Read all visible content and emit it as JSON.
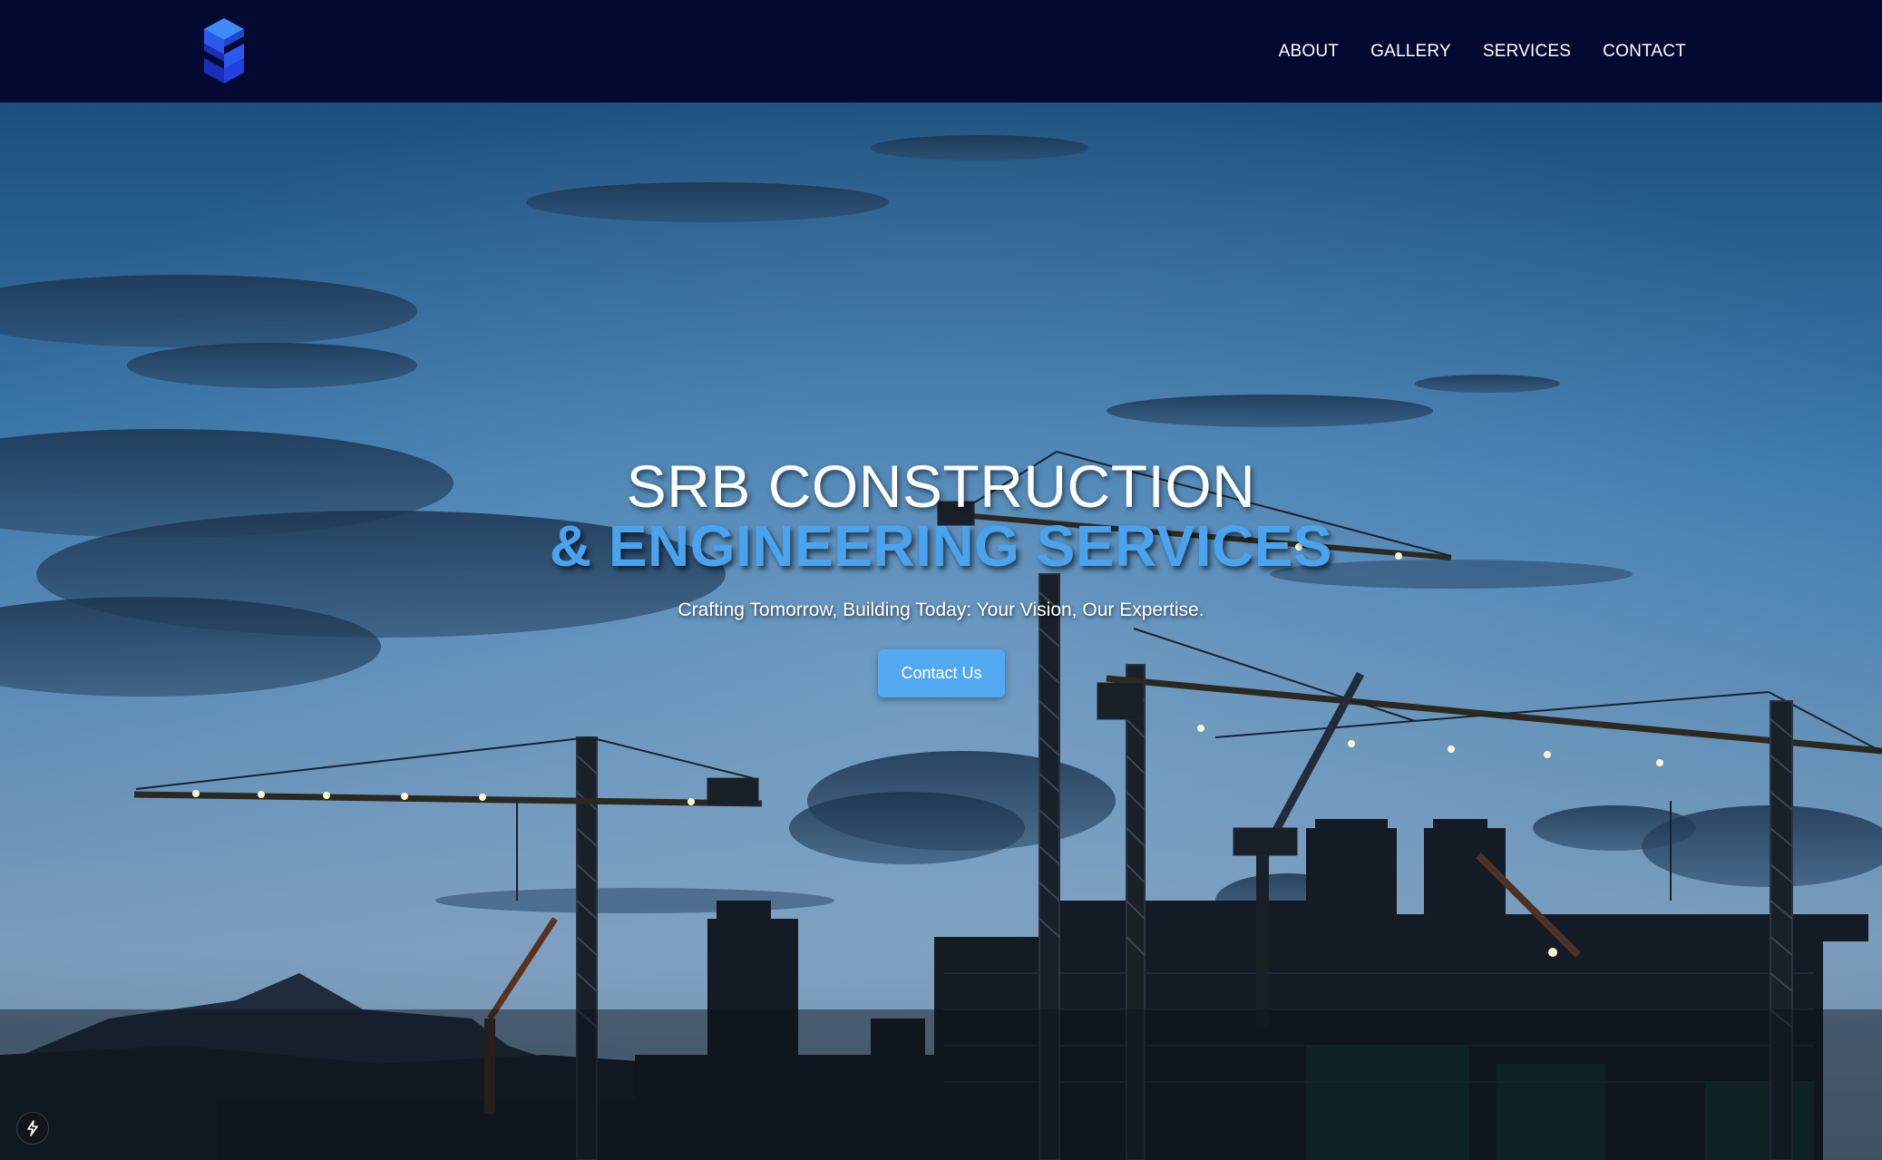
{
  "nav": {
    "items": [
      {
        "label": "ABOUT"
      },
      {
        "label": "GALLERY"
      },
      {
        "label": "SERVICES"
      },
      {
        "label": "CONTACT"
      }
    ]
  },
  "hero": {
    "title_line1": "SRB CONSTRUCTION",
    "title_line2": "& ENGINEERING SERVICES",
    "tagline": "Crafting Tomorrow, Building Today: Your Vision, Our Expertise.",
    "cta_label": "Contact Us"
  },
  "colors": {
    "navbar": "#030930",
    "accent": "#4aa3ee",
    "button": "#52a9f1",
    "logo_primary": "#2b59f0",
    "logo_dark": "#1a2fb8"
  },
  "icons": {
    "logo": "srb-logo-icon",
    "dev_badge": "lightning-bolt-icon"
  }
}
